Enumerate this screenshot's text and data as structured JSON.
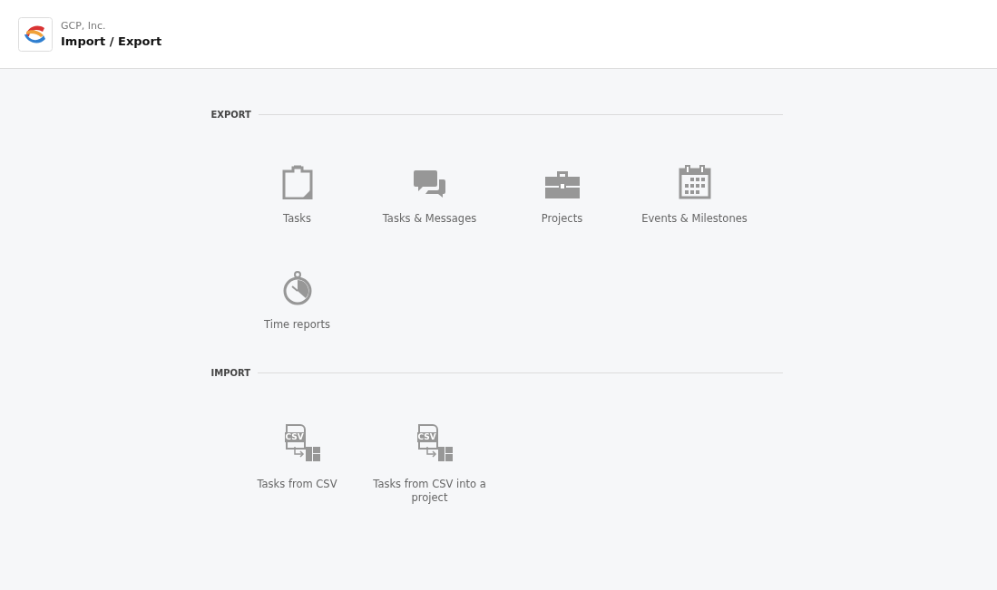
{
  "header": {
    "company": "GCP, Inc.",
    "title": "Import / Export"
  },
  "sections": [
    {
      "title": "EXPORT",
      "items": [
        {
          "kind": "clipboard",
          "label": "Tasks"
        },
        {
          "kind": "chat",
          "label": "Tasks & Messages"
        },
        {
          "kind": "briefcase",
          "label": "Projects"
        },
        {
          "kind": "calendar",
          "label": "Events & Milestones"
        },
        {
          "kind": "stopwatch",
          "label": "Time reports"
        }
      ]
    },
    {
      "title": "IMPORT",
      "items": [
        {
          "kind": "csv",
          "badge": "CSV",
          "label": "Tasks from CSV"
        },
        {
          "kind": "csv",
          "badge": "CSV",
          "label": "Tasks from CSV into a project"
        }
      ]
    }
  ]
}
